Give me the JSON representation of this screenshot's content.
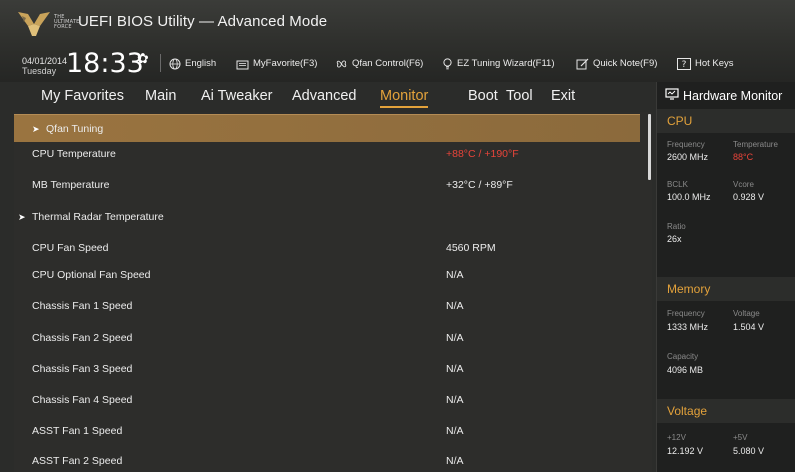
{
  "header": {
    "logo_text": [
      "THE",
      "ULTIMATE",
      "FORCE"
    ],
    "title": "UEFI BIOS Utility — Advanced Mode",
    "date": "04/01/2014",
    "day": "Tuesday",
    "time": "18:33",
    "items": {
      "language": "English",
      "favorite": "MyFavorite(F3)",
      "qfan": "Qfan Control(F6)",
      "ez_tuning": "EZ Tuning Wizard(F11)",
      "quick_note": "Quick Note(F9)",
      "hot_keys": "Hot Keys"
    }
  },
  "tabs": [
    {
      "label": "My Favorites"
    },
    {
      "label": "Main"
    },
    {
      "label": "Ai Tweaker"
    },
    {
      "label": "Advanced"
    },
    {
      "label": "Monitor"
    },
    {
      "label": "Boot"
    },
    {
      "label": "Tool"
    },
    {
      "label": "Exit"
    }
  ],
  "active_tab": "Monitor",
  "rows": [
    {
      "label": "Qfan Tuning",
      "value": "",
      "submenu": true,
      "selected": true
    },
    {
      "label": "CPU Temperature",
      "value": "+88°C / +190°F",
      "alert": true
    },
    {
      "label": "MB Temperature",
      "value": "+32°C / +89°F"
    },
    {
      "label": "Thermal Radar Temperature",
      "value": "",
      "submenu": true
    },
    {
      "label": "CPU Fan Speed",
      "value": "4560 RPM"
    },
    {
      "label": "CPU Optional Fan Speed",
      "value": "N/A"
    },
    {
      "label": "Chassis Fan 1 Speed",
      "value": "N/A"
    },
    {
      "label": "Chassis Fan 2 Speed",
      "value": "N/A"
    },
    {
      "label": "Chassis Fan 3 Speed",
      "value": "N/A"
    },
    {
      "label": "Chassis Fan 4 Speed",
      "value": "N/A"
    },
    {
      "label": "ASST Fan 1 Speed",
      "value": "N/A"
    },
    {
      "label": "ASST Fan 2 Speed",
      "value": "N/A"
    }
  ],
  "hardware_monitor": {
    "title": "Hardware Monitor",
    "cpu": {
      "title": "CPU",
      "frequency_label": "Frequency",
      "frequency": "2600 MHz",
      "temperature_label": "Temperature",
      "temperature": "88°C",
      "bclk_label": "BCLK",
      "bclk": "100.0 MHz",
      "vcore_label": "Vcore",
      "vcore": "0.928 V",
      "ratio_label": "Ratio",
      "ratio": "26x"
    },
    "memory": {
      "title": "Memory",
      "frequency_label": "Frequency",
      "frequency": "1333 MHz",
      "voltage_label": "Voltage",
      "voltage": "1.504 V",
      "capacity_label": "Capacity",
      "capacity": "4096 MB"
    },
    "voltage": {
      "title": "Voltage",
      "v12_label": "+12V",
      "v12": "12.192 V",
      "v5_label": "+5V",
      "v5": "5.080 V"
    }
  },
  "colors": {
    "accent": "#e3a23b",
    "alert": "#e8443a",
    "selected_row": "#9a7440",
    "panel_bg": "#1f201f"
  },
  "icons": {
    "time": "gear-icon",
    "language": "globe-icon",
    "favorite": "folder-icon",
    "qfan": "fan-icon",
    "ez_tuning": "bulb-icon",
    "quick_note": "note-icon",
    "hot_keys": "question-icon",
    "hw_title": "monitor-icon"
  }
}
